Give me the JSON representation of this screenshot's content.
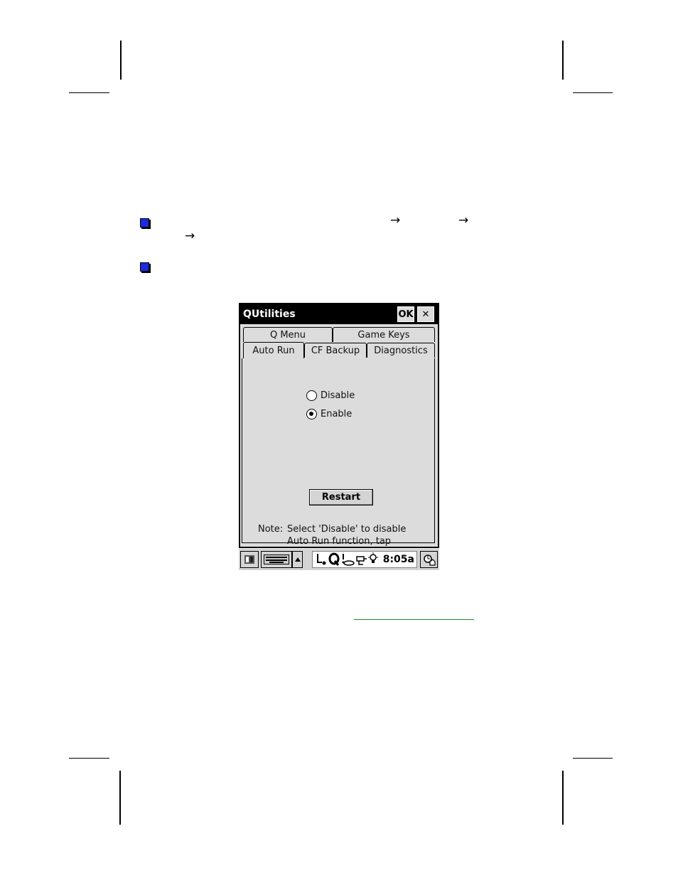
{
  "window": {
    "title": "QUtilities",
    "ok_label": "OK",
    "close_label": "✕"
  },
  "tabs": {
    "row1": [
      "Q Menu",
      "Game Keys"
    ],
    "row2": [
      "Auto Run",
      "CF Backup",
      "Diagnostics"
    ],
    "active": "Auto Run"
  },
  "options": {
    "disable_label": "Disable",
    "enable_label": "Enable",
    "selected": "Enable"
  },
  "restart_label": "Restart",
  "note": {
    "label": "Note:",
    "text": "Select 'Disable' to disable Auto Run function, tap Restart to start Auto Run function immediately."
  },
  "taskbar": {
    "clock": "8:05a",
    "icons": [
      "start-icon",
      "keyboard-icon",
      "up-arrow-icon",
      "connection-icon",
      "q-icon",
      "volume-icon",
      "power-icon",
      "backlight-icon",
      "desktop-icon"
    ]
  },
  "page": {
    "arrow_glyph": "→"
  }
}
